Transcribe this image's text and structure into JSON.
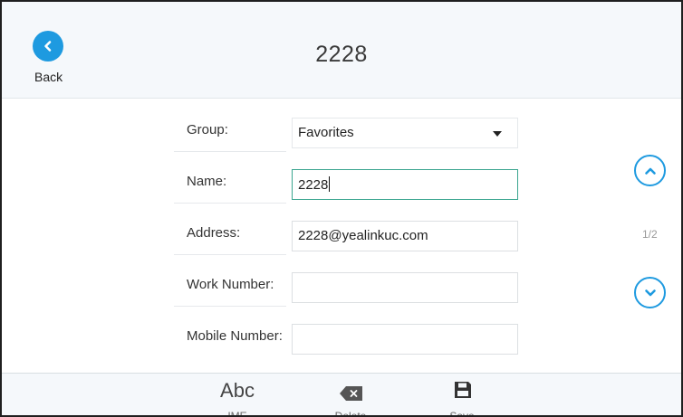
{
  "header": {
    "back_label": "Back",
    "title": "2228"
  },
  "form": {
    "group": {
      "label": "Group:",
      "value": "Favorites"
    },
    "name": {
      "label": "Name:",
      "value": "2228"
    },
    "address": {
      "label": "Address:",
      "value": "2228@yealinkuc.com"
    },
    "work_number": {
      "label": "Work Number:",
      "value": ""
    },
    "mobile_number": {
      "label": "Mobile Number:",
      "value": ""
    }
  },
  "pagination": {
    "indicator": "1/2"
  },
  "toolbar": {
    "ime_icon_text": "Abc",
    "ime_label": "IME",
    "delete_label": "Delete",
    "save_label": "Save"
  },
  "colors": {
    "accent": "#1e9ae0",
    "focus": "#3aa58f"
  },
  "icons": [
    "chevron-left-icon",
    "caret-down-icon",
    "chevron-up-icon",
    "chevron-down-icon",
    "backspace-icon",
    "floppy-disk-icon"
  ]
}
